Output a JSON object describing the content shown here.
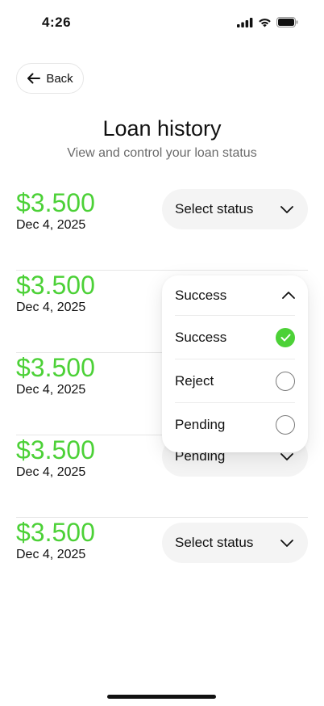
{
  "status_bar": {
    "time": "4:26"
  },
  "header": {
    "back_label": "Back",
    "title": "Loan history",
    "subtitle": "View and control your loan status"
  },
  "loans": [
    {
      "amount": "$3.500",
      "date": "Dec 4, 2025",
      "status": "Select status"
    },
    {
      "amount": "$3.500",
      "date": "Dec 4, 2025",
      "status": "Success"
    },
    {
      "amount": "$3.500",
      "date": "Dec 4, 2025",
      "status": ""
    },
    {
      "amount": "$3.500",
      "date": "Dec 4, 2025",
      "status": "Pending"
    },
    {
      "amount": "$3.500",
      "date": "Dec 4, 2025",
      "status": "Select status"
    }
  ],
  "dropdown": {
    "current": "Success",
    "options": [
      {
        "label": "Success",
        "selected": true
      },
      {
        "label": "Reject",
        "selected": false
      },
      {
        "label": "Pending",
        "selected": false
      }
    ]
  },
  "colors": {
    "accent_green": "#4cd137",
    "select_bg": "#f4f4f4"
  }
}
